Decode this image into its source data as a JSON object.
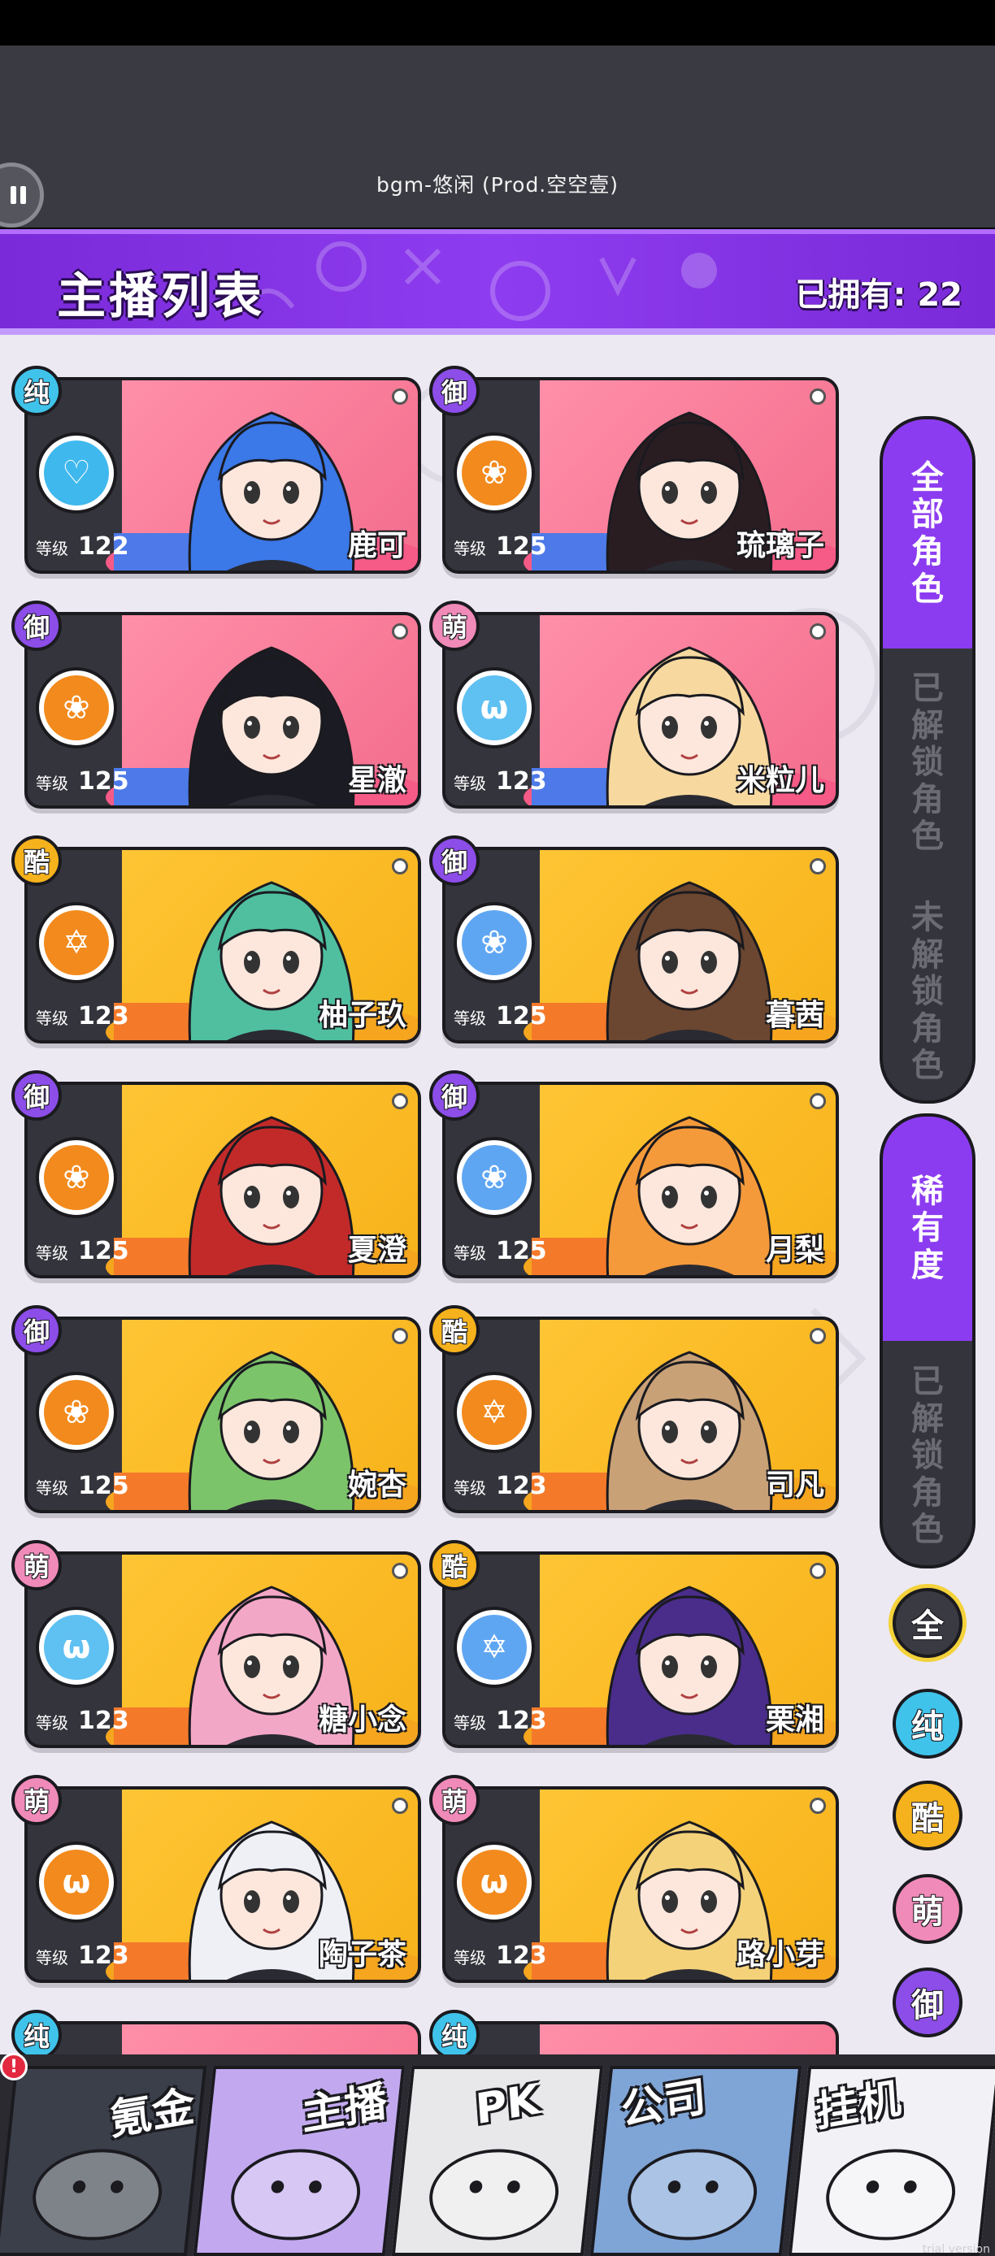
{
  "music": {
    "now_playing": "bgm-悠闲 (Prod.空空壹)"
  },
  "header": {
    "title": "主播列表",
    "owned": "已拥有: 22"
  },
  "type_colors": {
    "纯": "#3fc3ea",
    "御": "#8c4de8",
    "萌": "#f08ab8",
    "酷": "#f5b21c"
  },
  "characters": [
    {
      "name": "鹿可",
      "level": "122",
      "level_label": "等级",
      "type": "纯",
      "bg": "pink",
      "attr_icon": "heart-pulse-icon",
      "attr_color": "#3fb8ee",
      "glyph": "♡",
      "hair": "#3b78e8"
    },
    {
      "name": "琉璃子",
      "level": "125",
      "level_label": "等级",
      "type": "御",
      "bg": "pink",
      "attr_icon": "rose-icon",
      "attr_color": "#f28a1d",
      "glyph": "❀",
      "hair": "#2a1d22"
    },
    {
      "name": "星澈",
      "level": "125",
      "level_label": "等级",
      "type": "御",
      "bg": "pink",
      "attr_icon": "rose-icon",
      "attr_color": "#f28a1d",
      "glyph": "❀",
      "hair": "#1b1b24"
    },
    {
      "name": "米粒儿",
      "level": "123",
      "level_label": "等级",
      "type": "萌",
      "bg": "pink",
      "attr_icon": "cat-icon",
      "attr_color": "#5fc0f2",
      "glyph": "ω",
      "hair": "#f7d9a0"
    },
    {
      "name": "柚子玖",
      "level": "123",
      "level_label": "等级",
      "type": "酷",
      "bg": "yellow",
      "attr_icon": "star-icon",
      "attr_color": "#f28a1d",
      "glyph": "✡",
      "hair": "#4fbf9f"
    },
    {
      "name": "暮茜",
      "level": "125",
      "level_label": "等级",
      "type": "御",
      "bg": "yellow",
      "attr_icon": "rose-icon",
      "attr_color": "#5fa6f2",
      "glyph": "❀",
      "hair": "#6b4630"
    },
    {
      "name": "夏澄",
      "level": "125",
      "level_label": "等级",
      "type": "御",
      "bg": "yellow",
      "attr_icon": "rose-icon",
      "attr_color": "#f28a1d",
      "glyph": "❀",
      "hair": "#c22a2a"
    },
    {
      "name": "月梨",
      "level": "125",
      "level_label": "等级",
      "type": "御",
      "bg": "yellow",
      "attr_icon": "rose-icon",
      "attr_color": "#5fa6f2",
      "glyph": "❀",
      "hair": "#f49a3b"
    },
    {
      "name": "婉杏",
      "level": "125",
      "level_label": "等级",
      "type": "御",
      "bg": "yellow",
      "attr_icon": "rose-icon",
      "attr_color": "#f28a1d",
      "glyph": "❀",
      "hair": "#7cc46a"
    },
    {
      "name": "司凡",
      "level": "123",
      "level_label": "等级",
      "type": "酷",
      "bg": "yellow",
      "attr_icon": "star-icon",
      "attr_color": "#f28a1d",
      "glyph": "✡",
      "hair": "#c9a177"
    },
    {
      "name": "糖小念",
      "level": "123",
      "level_label": "等级",
      "type": "萌",
      "bg": "yellow",
      "attr_icon": "cat-icon",
      "attr_color": "#5fc0f2",
      "glyph": "ω",
      "hair": "#f3a7c6"
    },
    {
      "name": "栗湘",
      "level": "123",
      "level_label": "等级",
      "type": "酷",
      "bg": "yellow",
      "attr_icon": "star-icon",
      "attr_color": "#5fa6f2",
      "glyph": "✡",
      "hair": "#4a2d8a"
    },
    {
      "name": "陶子茶",
      "level": "123",
      "level_label": "等级",
      "type": "萌",
      "bg": "yellow",
      "attr_icon": "cat-icon",
      "attr_color": "#f28a1d",
      "glyph": "ω",
      "hair": "#eef0f5"
    },
    {
      "name": "路小芽",
      "level": "123",
      "level_label": "等级",
      "type": "萌",
      "bg": "yellow",
      "attr_icon": "cat-icon",
      "attr_color": "#f28a1d",
      "glyph": "ω",
      "hair": "#f4d27a"
    }
  ],
  "partial_badges": [
    "纯",
    "纯"
  ],
  "side_filter_1": [
    {
      "label": "全部角色",
      "active": true
    },
    {
      "label": "已解锁角色",
      "active": false
    },
    {
      "label": "未解锁角色",
      "active": false
    }
  ],
  "side_filter_2": [
    {
      "label": "稀有度",
      "active": true
    },
    {
      "label": "已解锁角色",
      "active": false
    }
  ],
  "type_filters": [
    "全",
    "纯",
    "酷",
    "萌",
    "御"
  ],
  "bottom_nav": [
    {
      "label": "氪金",
      "color": "#3a3f4a"
    },
    {
      "label": "主播",
      "color": "#c2a9ef"
    },
    {
      "label": "PK",
      "color": "#e8e8ea"
    },
    {
      "label": "公司",
      "color": "#7fa4d6"
    },
    {
      "label": "挂机",
      "color": "#f2f2f6"
    }
  ],
  "notice_badge": "!",
  "trial_text": "trial version"
}
